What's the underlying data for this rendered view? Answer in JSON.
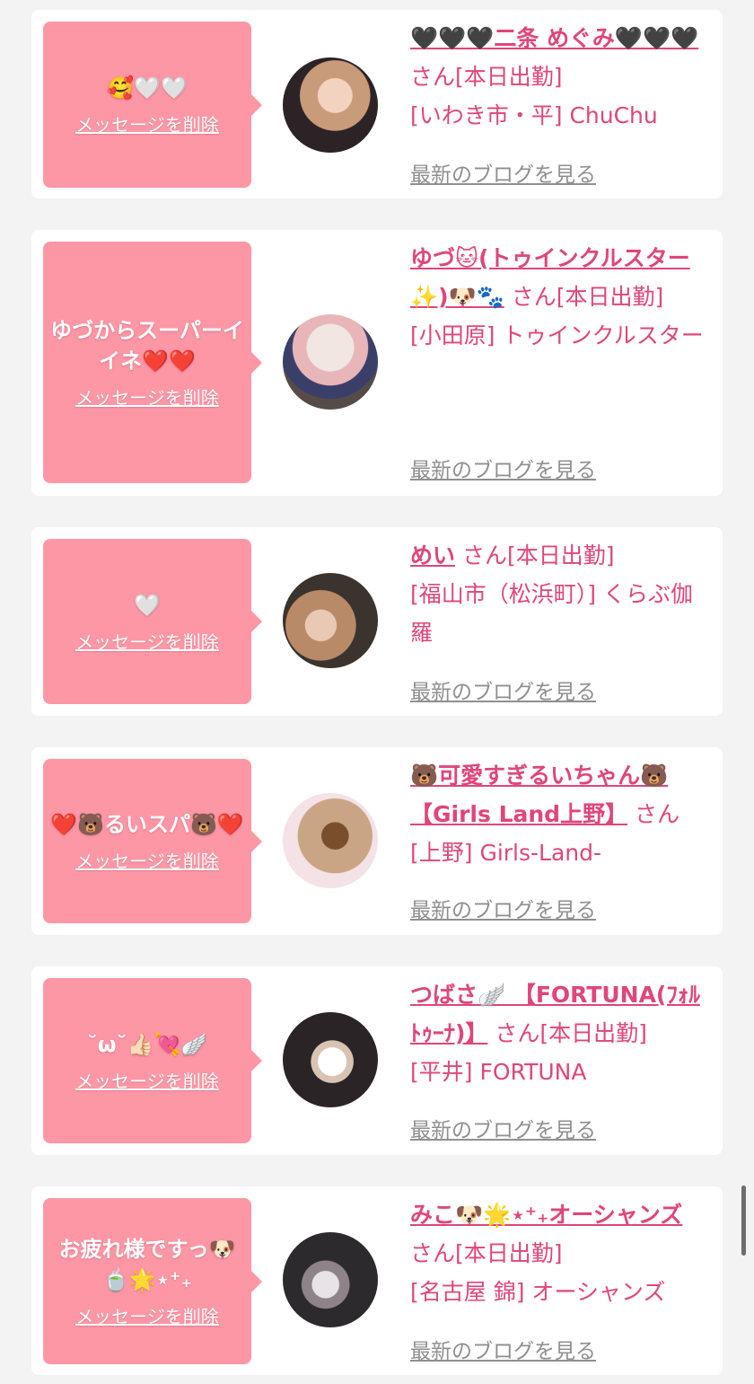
{
  "delete_label": "メッセージを削除",
  "blog_label": "最新のブログを見る",
  "san_label": "さん",
  "cards": [
    {
      "message": "🥰🤍🤍",
      "name": "🖤🖤🖤二条 めぐみ🖤🖤🖤",
      "status": "[本日出勤]",
      "shop": "[いわき市・平] ChuChu"
    },
    {
      "message": "ゆづからスーパーイイネ❤️❤️",
      "name": "ゆづ🐱(トゥインクルスター✨)🐶🐾",
      "status": "[本日出勤]",
      "shop": "[小田原] トゥインクルスター"
    },
    {
      "message": "🤍",
      "name": "めい",
      "status": "[本日出勤]",
      "shop": "[福山市（松浜町）] くらぶ伽羅"
    },
    {
      "message": "❤️🐻るいスパ🐻❤️",
      "name": "🐻可愛すぎるいちゃん🐻【Girls Land上野】",
      "status": "",
      "shop": "[上野] Girls-Land-"
    },
    {
      "message": "˘ω˘👍🏻💘🪽",
      "name": "つばさ🪽 【FORTUNA(ﾌｫﾙﾄｩｰﾅ)】",
      "status": "[本日出勤]",
      "shop": "[平井] FORTUNA"
    },
    {
      "message": "お疲れ様ですっ🐶🍵🌟⋆⁺₊",
      "name": "みこ🐶🌟⋆⁺₊オーシャンズ",
      "status": "[本日出勤]",
      "shop": "[名古屋 錦] オーシャンズ"
    }
  ]
}
